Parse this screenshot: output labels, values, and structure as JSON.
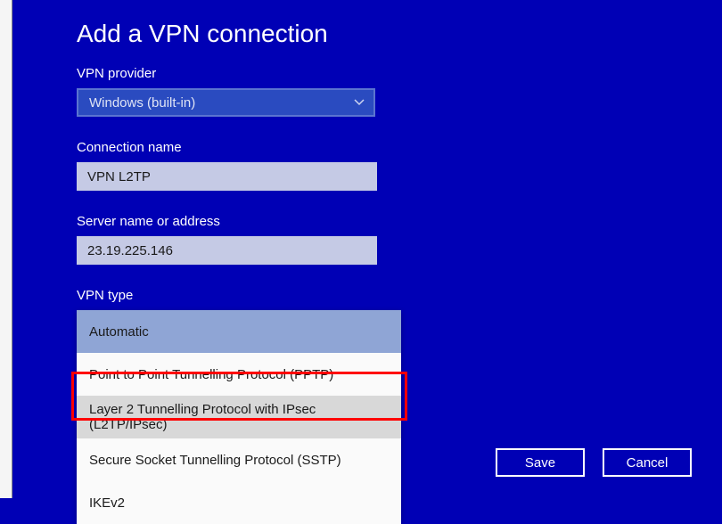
{
  "page": {
    "title": "Add a VPN connection"
  },
  "fields": {
    "provider": {
      "label": "VPN provider",
      "value": "Windows (built-in)"
    },
    "connectionName": {
      "label": "Connection name",
      "value": "VPN L2TP"
    },
    "serverAddress": {
      "label": "Server name or address",
      "value": "23.19.225.146"
    },
    "vpnType": {
      "label": "VPN type",
      "options": {
        "0": "Automatic",
        "1": "Point to Point Tunnelling Protocol (PPTP)",
        "2": "Layer 2 Tunnelling Protocol with IPsec (L2TP/IPsec)",
        "3": "Secure Socket Tunnelling Protocol (SSTP)",
        "4": "IKEv2"
      }
    }
  },
  "buttons": {
    "save": "Save",
    "cancel": "Cancel"
  }
}
